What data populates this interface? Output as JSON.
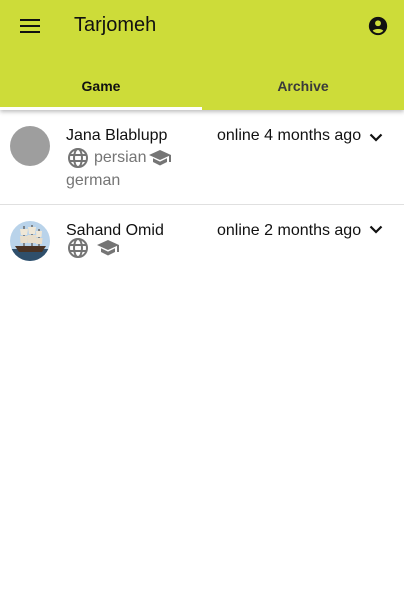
{
  "app": {
    "title": "Tarjomeh",
    "menu_icon": "menu-icon",
    "account_icon": "account-circle-icon",
    "accent": "#cddc39"
  },
  "tabs": [
    {
      "label": "Game",
      "active": true
    },
    {
      "label": "Archive",
      "active": false
    }
  ],
  "players": [
    {
      "name": "Jana Blablupp",
      "status": "online 4 months ago",
      "languages_icon": "globe-icon",
      "education_icon": "school-icon",
      "languages": [
        "persian",
        "german"
      ]
    },
    {
      "name": "Sahand Omid",
      "status": "online 2 months ago",
      "languages_icon": "globe-icon",
      "education_icon": "school-icon",
      "languages": []
    }
  ]
}
